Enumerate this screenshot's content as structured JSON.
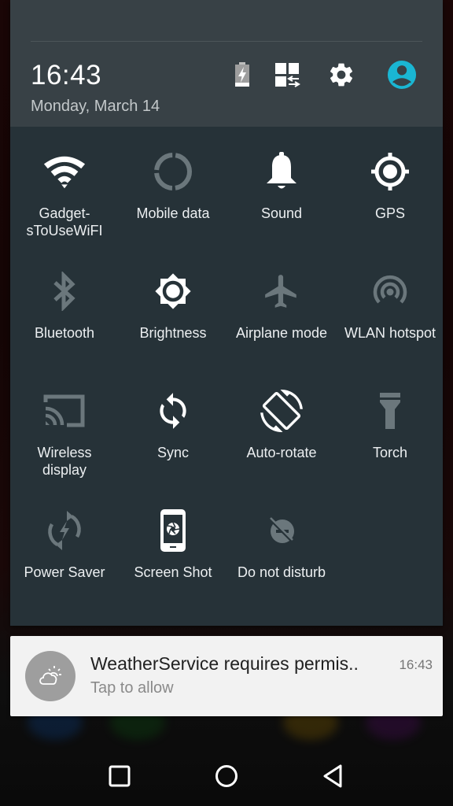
{
  "header": {
    "time": "16:43",
    "date": "Monday, March 14",
    "icons": [
      {
        "name": "battery-charging-icon"
      },
      {
        "name": "edit-tiles-icon"
      },
      {
        "name": "settings-gear-icon"
      },
      {
        "name": "user-account-icon",
        "color": "#1ab6d3"
      }
    ]
  },
  "tiles": [
    {
      "label": "Gadget-\nsToUseWiFI",
      "icon": "wifi-icon",
      "active": true
    },
    {
      "label": "Mobile data",
      "icon": "mobile-data-icon",
      "active": false
    },
    {
      "label": "Sound",
      "icon": "bell-icon",
      "active": true
    },
    {
      "label": "GPS",
      "icon": "gps-location-icon",
      "active": true
    },
    {
      "label": "Bluetooth",
      "icon": "bluetooth-icon",
      "active": false
    },
    {
      "label": "Brightness",
      "icon": "brightness-icon",
      "active": true
    },
    {
      "label": "Airplane mode",
      "icon": "airplane-icon",
      "active": false
    },
    {
      "label": "WLAN hotspot",
      "icon": "hotspot-icon",
      "active": false
    },
    {
      "label": "Wireless\ndisplay",
      "icon": "cast-icon",
      "active": false
    },
    {
      "label": "Sync",
      "icon": "sync-icon",
      "active": true
    },
    {
      "label": "Auto-rotate",
      "icon": "auto-rotate-icon",
      "active": true
    },
    {
      "label": "Torch",
      "icon": "torch-icon",
      "active": false
    },
    {
      "label": "Power Saver",
      "icon": "power-saver-icon",
      "active": false
    },
    {
      "label": "Screen Shot",
      "icon": "screenshot-icon",
      "active": true
    },
    {
      "label": "Do not disturb",
      "icon": "do-not-disturb-icon",
      "active": false
    }
  ],
  "notification": {
    "title": "WeatherService requires permis..",
    "time": "16:43",
    "text": "Tap to allow",
    "icon": "weather-partly-cloudy-icon"
  },
  "navbar": {
    "buttons": [
      "recents-button",
      "home-button",
      "back-button"
    ]
  },
  "colors": {
    "panel": "#263238",
    "header": "#384146",
    "active_icon": "#ffffff",
    "inactive_icon": "#6b777c",
    "accent": "#1ab6d3"
  }
}
